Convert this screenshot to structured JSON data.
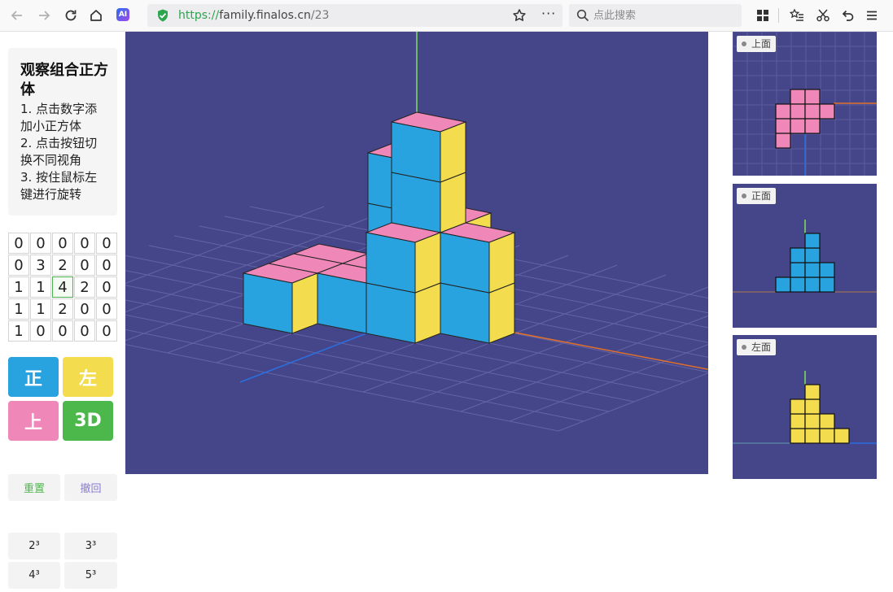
{
  "browser": {
    "url_scheme": "https://",
    "url_host": "family.finalos.cn",
    "url_path": "/23",
    "ai_badge": "AI",
    "more_dots": "···",
    "search_placeholder": "点此搜索"
  },
  "instructions": {
    "title": "观察组合正方体",
    "lines": [
      "1. 点击数字添加小正方体",
      "2. 点击按钮切换不同视角",
      "3. 按住鼠标左键进行旋转"
    ]
  },
  "grid": {
    "rows": [
      [
        0,
        0,
        0,
        0,
        0
      ],
      [
        0,
        3,
        2,
        0,
        0
      ],
      [
        1,
        1,
        4,
        2,
        0
      ],
      [
        1,
        1,
        2,
        0,
        0
      ],
      [
        1,
        0,
        0,
        0,
        0
      ]
    ],
    "selected": [
      2,
      2
    ]
  },
  "view_buttons": {
    "front": "正",
    "left": "左",
    "top": "上",
    "three_d": "3D"
  },
  "actions": {
    "reset": "重置",
    "undo": "撤回"
  },
  "size_buttons": [
    "2³",
    "3³",
    "4³",
    "5³"
  ],
  "side_views": {
    "top": "上面",
    "front": "正面",
    "left": "左面"
  },
  "colors": {
    "background": "#45458a",
    "top_face": "#ef88b8",
    "front_face": "#29a3df",
    "side_face": "#f3dc4e",
    "btn_front": "#29a3df",
    "btn_left": "#f3dc4e",
    "btn_top": "#ef88b8",
    "btn_3d": "#4cb84c"
  }
}
